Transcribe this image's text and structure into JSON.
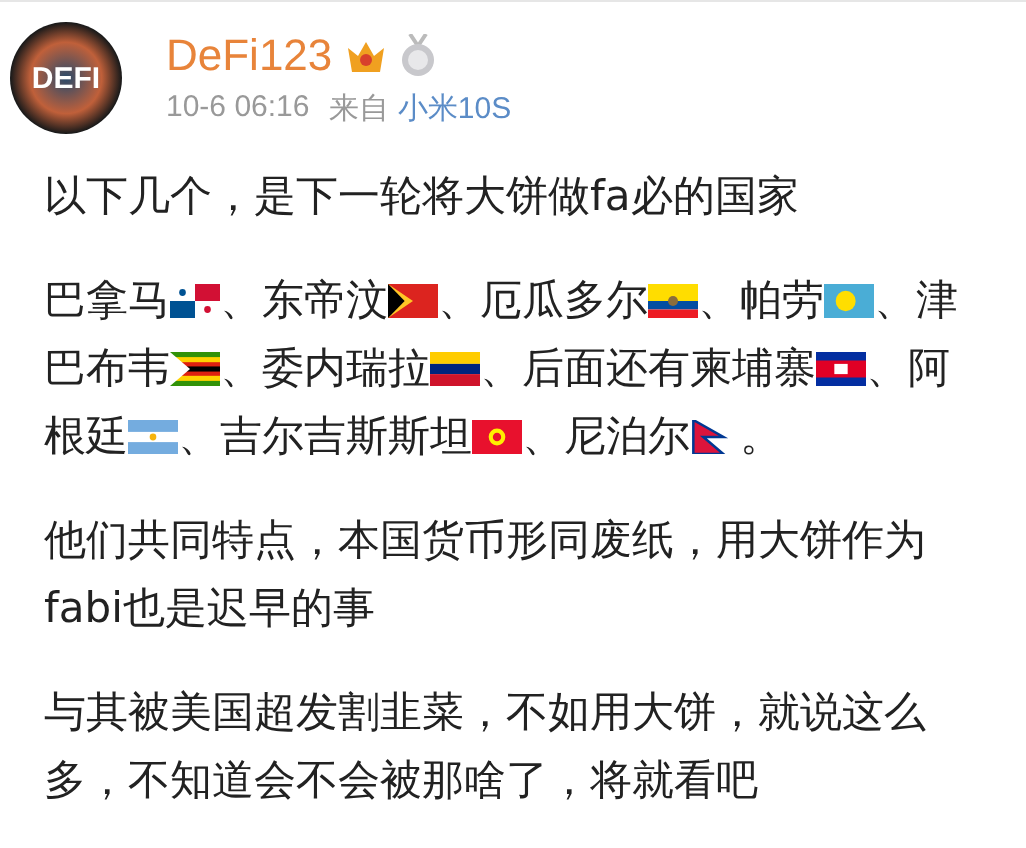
{
  "post": {
    "avatar_text": "DEFI",
    "username": "DeFi123",
    "badges": [
      {
        "kind": "crown"
      },
      {
        "kind": "medal"
      }
    ],
    "time": "10-6 06:16",
    "source_label": "来自",
    "source": "小米10S"
  },
  "paragraphs": [
    {
      "kind": "text",
      "text": "以下几个，是下一轮将大饼做fa必的国家"
    },
    {
      "kind": "flags",
      "segments": [
        {
          "text": "巴拿马",
          "kind": "panama"
        },
        {
          "text": "、东帝汶",
          "kind": "timor"
        },
        {
          "text": "、厄瓜多尔",
          "kind": "ecuador"
        },
        {
          "text": "、帕劳",
          "kind": "palau"
        },
        {
          "text": "、津"
        },
        {
          "text": "巴布韦",
          "kind": "zimbabwe"
        },
        {
          "text": "、委内瑞拉",
          "kind": "venezuela"
        },
        {
          "text": "、后面还有柬埔寨",
          "kind": "cambodia"
        },
        {
          "text": "、阿"
        },
        {
          "text": "根廷",
          "kind": "argentina"
        },
        {
          "text": "、吉尔吉斯斯坦",
          "kind": "kyrgyzstan"
        },
        {
          "text": "、尼泊尔",
          "kind": "nepal"
        }
      ],
      "end": "。"
    },
    {
      "kind": "text",
      "text": "他们共同特点，本国货币形同废纸，用大饼作为fabi也是迟早的事"
    },
    {
      "kind": "text",
      "text": "与其被美国超发割韭菜，不如用大饼，就说这么多，不知道会不会被那啥了，将就看吧"
    }
  ]
}
